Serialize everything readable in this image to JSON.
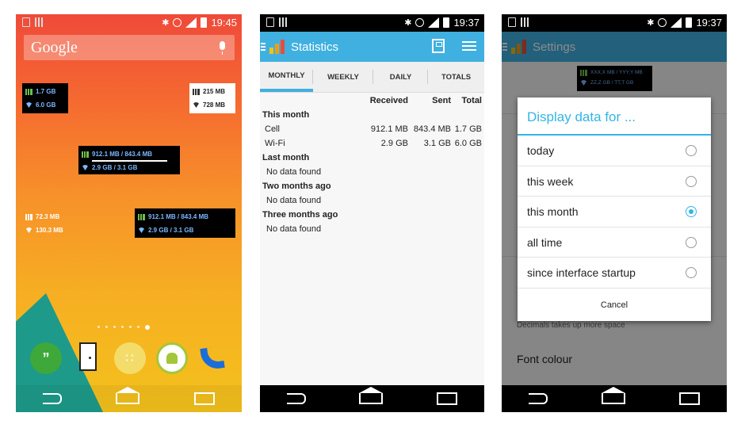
{
  "colors": {
    "accent": "#3fb0e0",
    "holo_blue": "#33b5e5",
    "widget_blue": "#7ab8ff"
  },
  "launcher": {
    "status_time": "19:45",
    "search_logo": "Google",
    "widgets": [
      {
        "cell": "1.7 GB",
        "wifi": "6.0 GB"
      },
      {
        "cell": "215 MB",
        "wifi": "728 MB"
      },
      {
        "cell": "912.1 MB / 843.4 MB",
        "wifi": "2.9 GB / 3.1 GB"
      },
      {
        "cell": "72.3 MB",
        "wifi": "130.3 MB"
      },
      {
        "cell": "912.1 MB / 843.4 MB",
        "wifi": "2.9 GB / 3.1 GB"
      }
    ],
    "page_dots": 7,
    "active_dot": 6,
    "dock_apps": [
      "hangouts-icon",
      "door-icon",
      "apps-drawer-icon",
      "android-icon",
      "phone-icon"
    ],
    "hangouts_glyph": "”",
    "apps_glyph": "∷"
  },
  "statistics": {
    "status_time": "19:37",
    "title": "Statistics",
    "tabs": [
      "MONTHLY",
      "WEEKLY",
      "DAILY",
      "TOTALS"
    ],
    "active_tab": "MONTHLY",
    "columns": [
      "Received",
      "Sent",
      "Total"
    ],
    "sections": [
      {
        "name": "This month",
        "rows": [
          {
            "label": "Cell",
            "received": "912.1 MB",
            "sent": "843.4 MB",
            "total": "1.7 GB"
          },
          {
            "label": "Wi-Fi",
            "received": "2.9 GB",
            "sent": "3.1 GB",
            "total": "6.0 GB"
          }
        ]
      },
      {
        "name": "Last month",
        "empty": "No data found"
      },
      {
        "name": "Two months ago",
        "empty": "No data found"
      },
      {
        "name": "Three months ago",
        "empty": "No data found"
      }
    ]
  },
  "settings": {
    "status_time": "19:37",
    "title": "Settings",
    "mini_widget": {
      "cell": "XXX,X MB / YYY,Y MB",
      "wifi": "ZZ,Z GB / TT,T GB"
    },
    "bg_summary": "Decimals takes up more space",
    "bg_font_colour": "Font colour",
    "dialog": {
      "title": "Display data for ...",
      "options": [
        "today",
        "this week",
        "this month",
        "all time",
        "since interface startup"
      ],
      "selected": "this month",
      "cancel": "Cancel"
    }
  }
}
